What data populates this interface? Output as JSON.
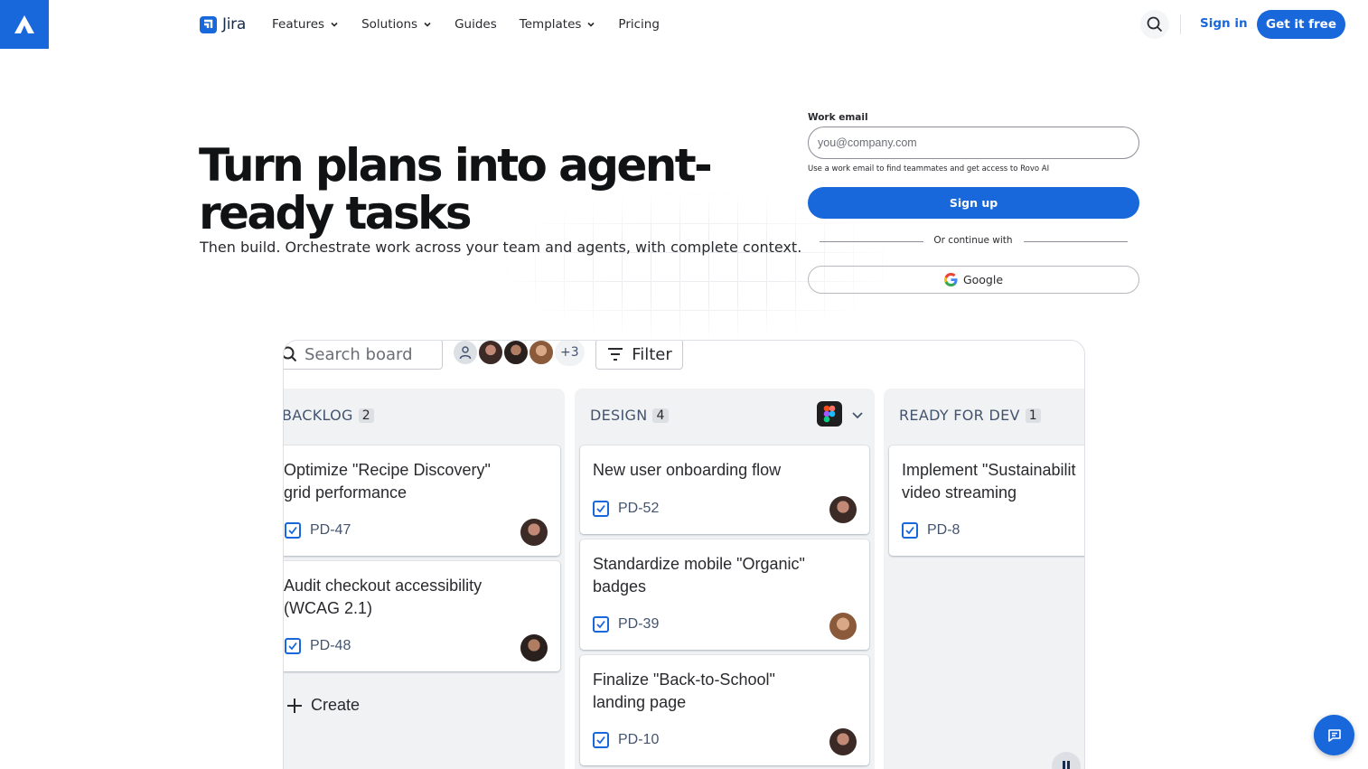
{
  "header": {
    "brand": "Jira",
    "nav": [
      {
        "label": "Features",
        "has_dropdown": true
      },
      {
        "label": "Solutions",
        "has_dropdown": true
      },
      {
        "label": "Guides",
        "has_dropdown": false
      },
      {
        "label": "Templates",
        "has_dropdown": true
      },
      {
        "label": "Pricing",
        "has_dropdown": false
      }
    ],
    "sign_in": "Sign in",
    "get_free": "Get it free"
  },
  "hero": {
    "title": "Turn plans into agent-ready tasks",
    "subtitle": "Then build. Orchestrate work across your team and agents, with complete context."
  },
  "form": {
    "label": "Work email",
    "placeholder": "you@company.com",
    "value": "",
    "help": "Use a work email to find teammates and get access to Rovo AI",
    "signup": "Sign up",
    "or_continue": "Or continue with",
    "google": "Google"
  },
  "board": {
    "search_placeholder": "Search board",
    "avatar_more": "+3",
    "filter": "Filter",
    "columns": [
      {
        "name": "BACKLOG",
        "count": "2",
        "cards": [
          {
            "title": "Optimize \"Recipe Discovery\" grid performance",
            "key": "PD-47"
          },
          {
            "title": "Audit checkout accessibility (WCAG 2.1)",
            "key": "PD-48"
          }
        ],
        "create": "Create"
      },
      {
        "name": "DESIGN",
        "count": "4",
        "cards": [
          {
            "title": "New user onboarding flow",
            "key": "PD-52"
          },
          {
            "title": "Standardize mobile \"Organic\" badges",
            "key": "PD-39"
          },
          {
            "title": "Finalize \"Back-to-School\" landing page",
            "key": "PD-10"
          }
        ]
      },
      {
        "name": "READY FOR DEV",
        "count": "1",
        "cards": [
          {
            "title": "Implement \"Sustainabilit video streaming",
            "key": "PD-8"
          }
        ]
      }
    ]
  },
  "colors": {
    "brand_blue": "#1868db",
    "text_dark": "#101214",
    "column_bg": "#f1f2f4"
  },
  "icons": [
    "atlassian-logo-icon",
    "jira-logo-icon",
    "chevron-down-icon",
    "search-icon",
    "google-icon",
    "filter-icon",
    "checkbox-icon",
    "plus-icon",
    "figma-icon",
    "chat-icon",
    "pause-icon"
  ]
}
